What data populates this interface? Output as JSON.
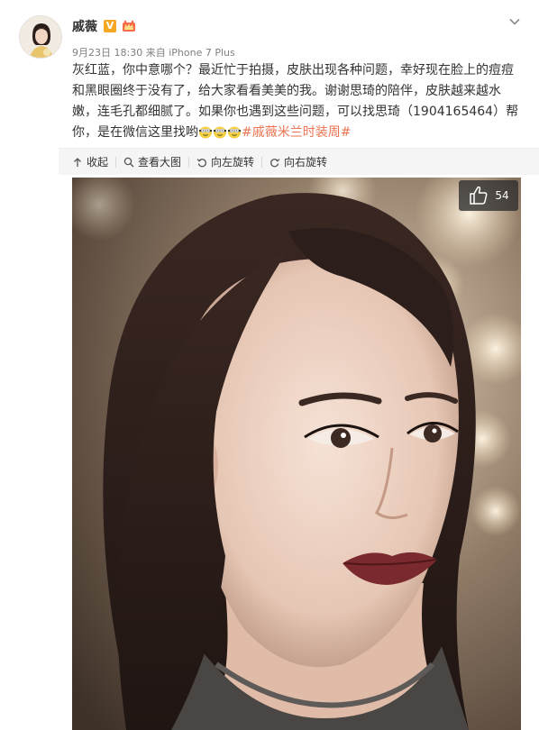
{
  "post": {
    "author": {
      "name": "戚薇",
      "vip_badge": "V",
      "avatar_icon": "avatar-portrait",
      "badge_icon": "member-crown-icon"
    },
    "meta": {
      "date": "9月23日 18:30",
      "source_prefix": "来自",
      "device": "iPhone 7 Plus"
    },
    "text": {
      "line1": "灰红蓝，你中意哪个？最近忙于拍摄，皮肤出现各种问题，幸好现在脸上的痘痘",
      "line2": "和黑眼圈终于没有了，给大家看看美美的我。谢谢思琦的陪伴，皮肤越来越水",
      "line3": "嫩，连毛孔都细腻了。如果你也遇到这些问题，可以找思琦（1904165464）帮",
      "line4_start": "你，是在微信这里找哟",
      "hashtag": "#戚薇米兰时装周#"
    },
    "toolbar": {
      "collapse": "收起",
      "view_large": "查看大图",
      "rotate_left": "向左旋转",
      "rotate_right": "向右旋转"
    },
    "photo": {
      "like_count": "54"
    }
  },
  "colors": {
    "accent_link": "#eb7350",
    "meta_gray": "#808080",
    "toolbar_bg": "#f5f5f5",
    "vip_badge": "#f5a623"
  }
}
